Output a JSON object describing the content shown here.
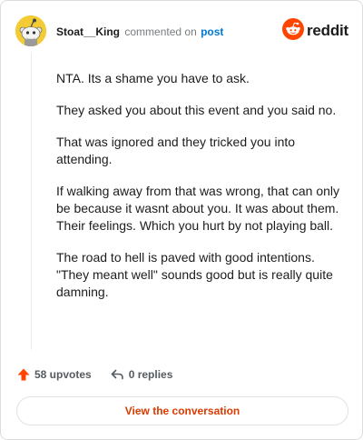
{
  "header": {
    "username": "Stoat__King",
    "action_text": "commented on",
    "post_link": "post",
    "brand": "reddit"
  },
  "comment": {
    "paragraphs": [
      "NTA. Its a shame you have to ask.",
      "They asked you about this event and you said no.",
      "That was ignored and they tricked you into attending.",
      "If walking away from that was wrong, that can only be because it wasnt about you. It was about them. Their feelings. Which you hurt by not playing ball.",
      "The road to hell is paved with good intentions. \"They meant well\" sounds good but is really quite damning."
    ]
  },
  "actions": {
    "upvotes": "58 upvotes",
    "replies": "0 replies",
    "view_button": "View the conversation"
  },
  "colors": {
    "accent": "#ff4500",
    "link": "#0079d3",
    "button_text": "#d93a00",
    "avatar_bg": "#f2cb35"
  },
  "icons": {
    "avatar": "snoo-avatar-icon",
    "brand": "reddit-logo-icon",
    "upvote": "upvote-arrow-icon",
    "reply": "reply-arrow-icon"
  }
}
